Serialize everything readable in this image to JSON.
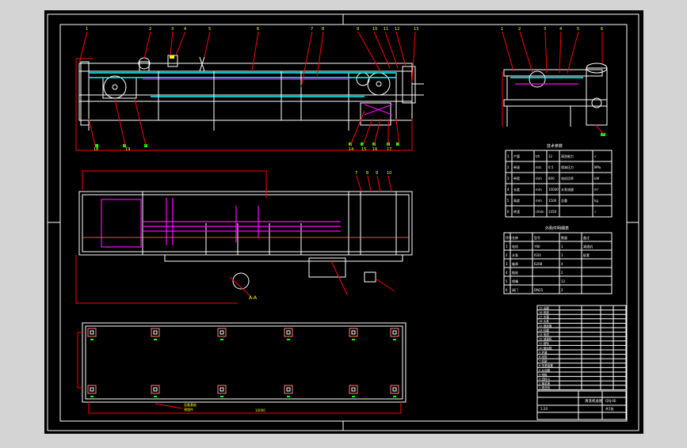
{
  "viewer": {
    "background": "#d4d4d4",
    "paper": "#000000",
    "frame_color": "#ffffff"
  },
  "colors": {
    "outline": "#ffffff",
    "leader": "#ff0000",
    "belt": "#00ffff",
    "rail": "#ff00ff",
    "green": "#00ff00",
    "yellow": "#ffff00",
    "ghost": "#ff8080"
  },
  "drawing": {
    "callouts_main": [
      "1",
      "2",
      "3",
      "4",
      "5",
      "6",
      "7",
      "8",
      "9",
      "10",
      "11",
      "12",
      "13"
    ],
    "callouts_side": [
      "1",
      "2",
      "3",
      "4",
      "5",
      "6"
    ],
    "callouts_plan": [
      "7",
      "8",
      "9",
      "10"
    ],
    "callouts_bottom": [
      "14",
      "15",
      "16",
      "17",
      "18",
      "19"
    ],
    "section_label": "A-A",
    "base_note_1": "设备基础",
    "base_note_2": "预埋件",
    "base_dim": "10000"
  },
  "tables": {
    "tech_title": "技术参数",
    "tech_rows": [
      [
        "1",
        "产量",
        "t/h",
        "12",
        "清洗能力",
        "√"
      ],
      [
        "2",
        "带速",
        "m/s",
        "0.5",
        "喷淋压力",
        "MPa"
      ],
      [
        "3",
        "带宽",
        "mm",
        "800",
        "电机功率",
        "kW"
      ],
      [
        "4",
        "长度",
        "mm",
        "10000",
        "水泵流量",
        "m³"
      ],
      [
        "5",
        "高度",
        "mm",
        "1500",
        "总重",
        "kg"
      ],
      [
        "6",
        "转速",
        "r/min",
        "1450",
        "",
        "√"
      ]
    ],
    "parts_title": "外购件明细表",
    "parts_head": [
      "序号",
      "名称",
      "型号",
      "数量",
      "备注"
    ],
    "parts_rows": [
      [
        "1",
        "电机",
        "Y90",
        "1",
        "减速机"
      ],
      [
        "2",
        "水泵",
        "IS50",
        "1",
        "配套"
      ],
      [
        "3",
        "轴承",
        "6208",
        "4",
        ""
      ],
      [
        "4",
        "链轮",
        "",
        "2",
        ""
      ],
      [
        "5",
        "喷嘴",
        "",
        "12",
        ""
      ],
      [
        "6",
        "阀门",
        "DN25",
        "2",
        ""
      ]
    ],
    "bom_rows": [
      "19 支腿",
      "18 底座",
      "17 水箱",
      "16 水泵",
      "15 喷淋管",
      "14 托辊",
      "13 电机",
      "12 减速机",
      "11 链轮",
      "10 驱动辊",
      "9 护罩",
      "8 网带",
      "7 机架",
      "6 张紧装置",
      "5 从动辊",
      "4 挡板",
      "3 进料斗",
      "2 轴承座",
      "1 清洗机"
    ],
    "title_block": {
      "name": "清洗机总图",
      "drawing_no": "QXJ-00",
      "scale": "1:20",
      "sheet": "共1张"
    }
  }
}
